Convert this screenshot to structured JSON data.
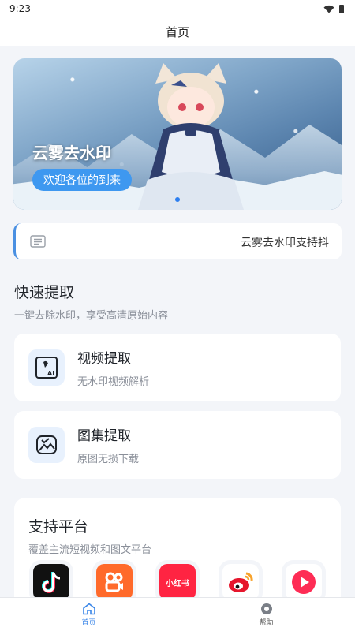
{
  "status_bar": {
    "time": "9:23"
  },
  "header": {
    "title": "首页"
  },
  "banner": {
    "title": "云雾去水印",
    "subtitle": "欢迎各位的到来",
    "page_count": 1,
    "active_page": 1
  },
  "notice": {
    "text": "云雾去水印支持抖"
  },
  "quick": {
    "title": "快速提取",
    "subtitle": "一键去除水印，享受高清原始内容",
    "items": [
      {
        "title": "视频提取",
        "desc": "无水印视频解析",
        "icon": "video-ai-icon"
      },
      {
        "title": "图集提取",
        "desc": "原图无损下载",
        "icon": "image-gallery-icon"
      }
    ]
  },
  "platforms": {
    "title": "支持平台",
    "subtitle": "覆盖主流短视频和图文平台",
    "items": [
      {
        "name": "douyin",
        "color": "#111111"
      },
      {
        "name": "kuaishou",
        "color": "#ff6a2b"
      },
      {
        "name": "xiaohongshu",
        "color": "#ff2442",
        "label": "小红书"
      },
      {
        "name": "weibo",
        "color": "#e6162d"
      },
      {
        "name": "video",
        "color": "#fe2c55"
      }
    ]
  },
  "tabbar": {
    "home": "首页",
    "help": "帮助"
  },
  "colors": {
    "accent": "#3a86e8",
    "background": "#f3f5f9"
  }
}
